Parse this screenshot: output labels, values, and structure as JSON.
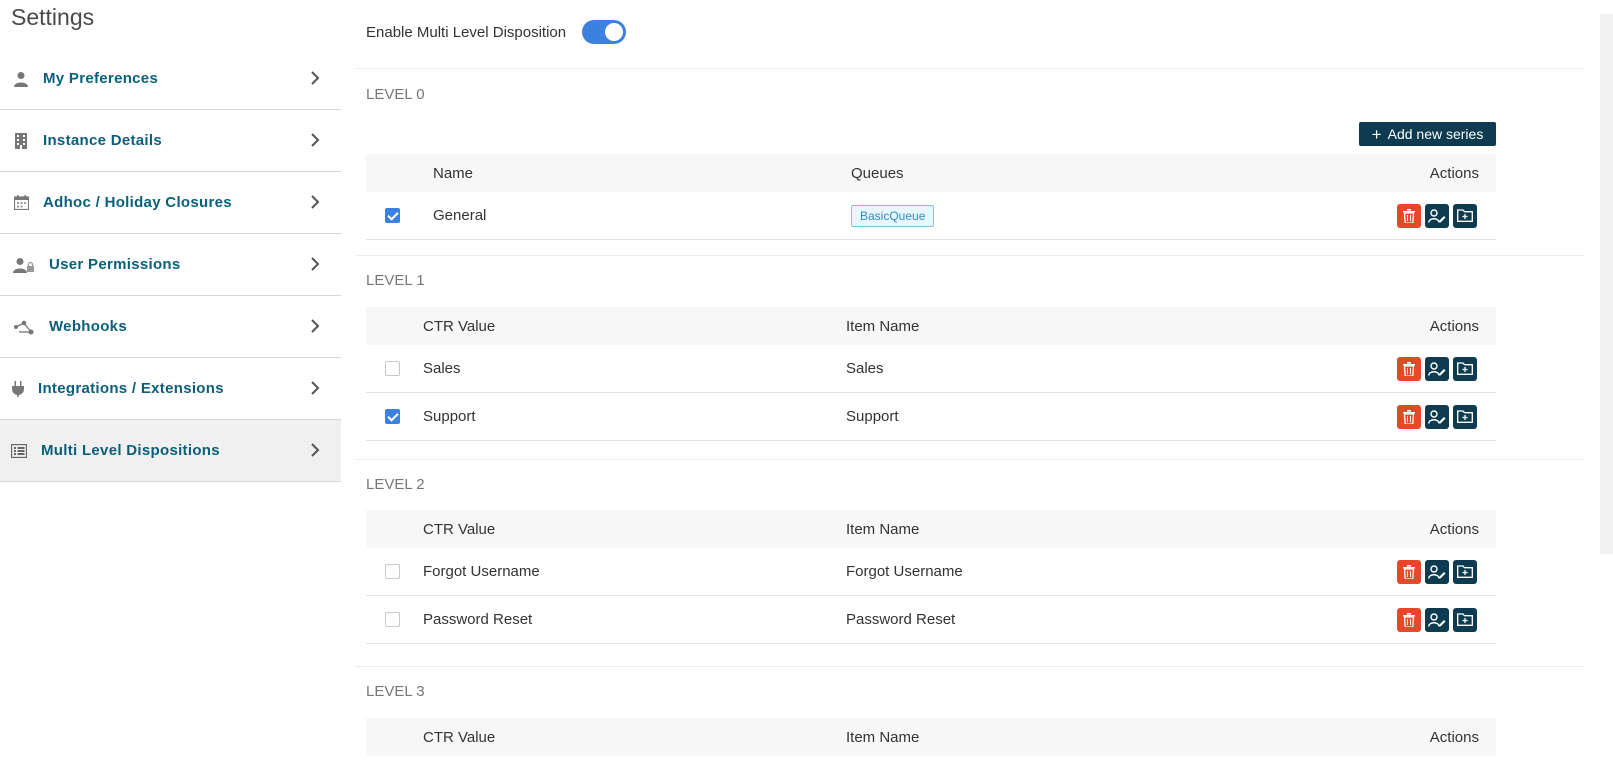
{
  "sidebar": {
    "title": "Settings",
    "items": [
      {
        "label": "My Preferences",
        "icon": "user-icon"
      },
      {
        "label": "Instance Details",
        "icon": "building-icon"
      },
      {
        "label": "Adhoc / Holiday Closures",
        "icon": "calendar-icon"
      },
      {
        "label": "User Permissions",
        "icon": "user-lock-icon"
      },
      {
        "label": "Webhooks",
        "icon": "webhook-icon"
      },
      {
        "label": "Integrations / Extensions",
        "icon": "plug-icon"
      },
      {
        "label": "Multi Level Dispositions",
        "icon": "list-icon",
        "active": true
      }
    ]
  },
  "main": {
    "toggle_label": "Enable Multi Level Disposition",
    "toggle_on": true,
    "add_button": "Add new series",
    "levels": [
      {
        "title": "LEVEL 0",
        "headers": [
          "Name",
          "Queues",
          "Actions"
        ],
        "rows": [
          {
            "checked": true,
            "name": "General",
            "queue": "BasicQueue"
          }
        ]
      },
      {
        "title": "LEVEL 1",
        "headers": [
          "CTR Value",
          "Item Name",
          "Actions"
        ],
        "rows": [
          {
            "checked": false,
            "ctr": "Sales",
            "item": "Sales"
          },
          {
            "checked": true,
            "ctr": "Support",
            "item": "Support"
          }
        ]
      },
      {
        "title": "LEVEL 2",
        "headers": [
          "CTR Value",
          "Item Name",
          "Actions"
        ],
        "rows": [
          {
            "checked": false,
            "ctr": "Forgot Username",
            "item": "Forgot Username"
          },
          {
            "checked": false,
            "ctr": "Password Reset",
            "item": "Password Reset"
          }
        ]
      },
      {
        "title": "LEVEL 3",
        "headers": [
          "CTR Value",
          "Item Name",
          "Actions"
        ],
        "rows": []
      }
    ]
  },
  "colors": {
    "accent": "#3b82e0",
    "nav_text": "#0b5f7a",
    "dark_button": "#0e3b4f",
    "delete_button": "#e5482a"
  }
}
